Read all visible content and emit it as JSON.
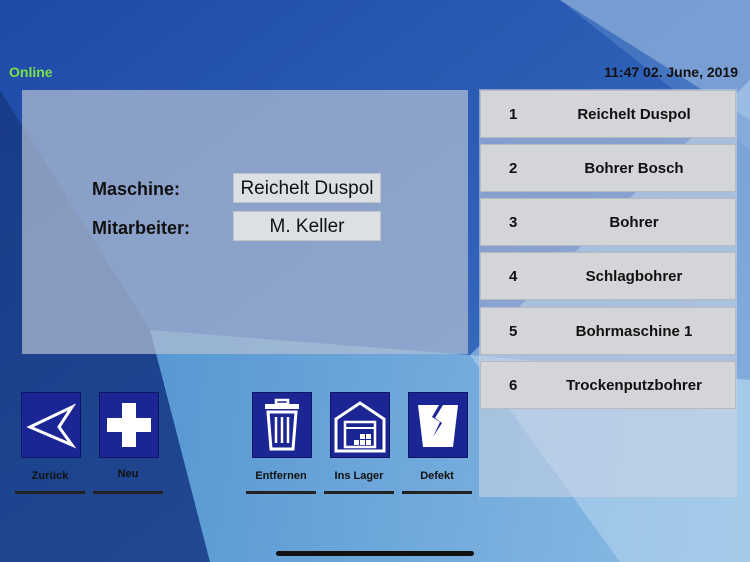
{
  "status": {
    "connection": "Online",
    "datetime": "11:47 02. June, 2019",
    "connection_color": "#7de04a"
  },
  "detail": {
    "machine_label": "Maschine:",
    "machine_value": "Reichelt Duspol",
    "employee_label": "Mitarbeiter:",
    "employee_value": "M. Keller"
  },
  "list": {
    "items": [
      {
        "num": "1",
        "name": "Reichelt Duspol"
      },
      {
        "num": "2",
        "name": "Bohrer Bosch"
      },
      {
        "num": "3",
        "name": "Bohrer"
      },
      {
        "num": "4",
        "name": "Schlagbohrer"
      },
      {
        "num": "5",
        "name": "Bohrmaschine 1"
      },
      {
        "num": "6",
        "name": "Trockenputzbohrer"
      }
    ]
  },
  "toolbar": {
    "back_label": "Zurück",
    "new_label": "Neu",
    "remove_label": "Entfernen",
    "storage_label": "Ins Lager",
    "defect_label": "Defekt",
    "accent_color": "#1b2594"
  },
  "icons": {
    "back": "back-arrow-icon",
    "new": "plus-icon",
    "remove": "trash-icon",
    "storage": "warehouse-icon",
    "defect": "broken-item-icon"
  }
}
